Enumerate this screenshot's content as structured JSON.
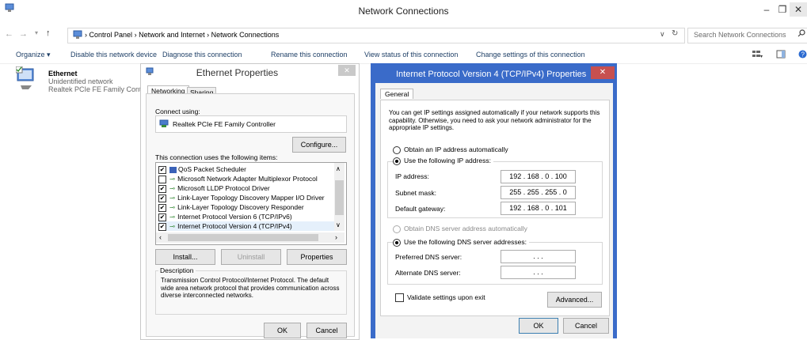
{
  "window": {
    "title": "Network Connections",
    "controls": {
      "minimize": "–",
      "maximize": "❐",
      "close": "✕"
    }
  },
  "address": {
    "back": "←",
    "forward": "→",
    "up": "↑",
    "breadcrumb": [
      "Control Panel",
      "Network and Internet",
      "Network Connections"
    ],
    "separator": "›",
    "refresh": "↻",
    "dropdown": "∨",
    "search_placeholder": "Search Network Connections"
  },
  "commands": {
    "organize": "Organize ▾",
    "disable": "Disable this network device",
    "diagnose": "Diagnose this connection",
    "rename": "Rename this connection",
    "view_status": "View status of this connection",
    "change_settings": "Change settings of this connection"
  },
  "connection": {
    "name": "Ethernet",
    "status": "Unidentified network",
    "adapter": "Realtek PCIe FE Family Contr"
  },
  "ethernet_dialog": {
    "title": "Ethernet Properties",
    "tabs": [
      "Networking",
      "Sharing"
    ],
    "connect_using_label": "Connect using:",
    "adapter_name": "Realtek PCIe FE Family Controller",
    "configure_label": "Configure...",
    "items_label": "This connection uses the following items:",
    "items": [
      {
        "label": "QoS Packet Scheduler",
        "checked": true
      },
      {
        "label": "Microsoft Network Adapter Multiplexor Protocol",
        "checked": false
      },
      {
        "label": "Microsoft LLDP Protocol Driver",
        "checked": true
      },
      {
        "label": "Link-Layer Topology Discovery Mapper I/O Driver",
        "checked": true
      },
      {
        "label": "Link-Layer Topology Discovery Responder",
        "checked": true
      },
      {
        "label": "Internet Protocol Version 6 (TCP/IPv6)",
        "checked": true
      },
      {
        "label": "Internet Protocol Version 4 (TCP/IPv4)",
        "checked": true
      }
    ],
    "install_label": "Install...",
    "uninstall_label": "Uninstall",
    "properties_label": "Properties",
    "description_label": "Description",
    "description_text": "Transmission Control Protocol/Internet Protocol. The default wide area network protocol that provides communication across diverse interconnected networks.",
    "ok_label": "OK",
    "cancel_label": "Cancel"
  },
  "ipv4_dialog": {
    "title": "Internet Protocol Version 4 (TCP/IPv4) Properties",
    "tab": "General",
    "intro": "You can get IP settings assigned automatically if your network supports this capability. Otherwise, you need to ask your network administrator for the appropriate IP settings.",
    "obtain_ip_auto": "Obtain an IP address automatically",
    "use_following_ip": "Use the following IP address:",
    "ip_address_label": "IP address:",
    "ip_address": "192 . 168 . 0 . 100",
    "subnet_label": "Subnet mask:",
    "subnet": "255 . 255 . 255 . 0",
    "gateway_label": "Default gateway:",
    "gateway": "192 . 168 . 0 . 101",
    "obtain_dns_auto": "Obtain DNS server address automatically",
    "use_following_dns": "Use the following DNS server addresses:",
    "preferred_dns_label": "Preferred DNS server:",
    "preferred_dns": ".       .       .",
    "alternate_dns_label": "Alternate DNS server:",
    "alternate_dns": ".       .       .",
    "validate_label": "Validate settings upon exit",
    "advanced_label": "Advanced...",
    "ok_label": "OK",
    "cancel_label": "Cancel",
    "close": "✕"
  },
  "colors": {
    "accent": "#3a6bc9",
    "close_red": "#c75050",
    "link": "#1e3f66"
  }
}
